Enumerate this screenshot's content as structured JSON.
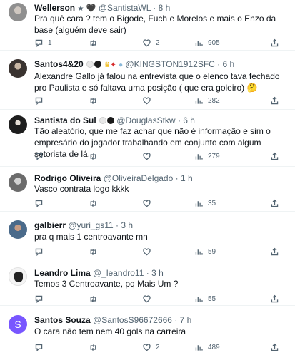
{
  "tweets": [
    {
      "name": "Wellerson",
      "name_suffix": "★",
      "handle": "@SantistaWL",
      "time": "8 h",
      "text": "Pra quê cara ? tem o Bigode, Fuch e Morelos e mais o Enzo da base (alguém deve sair)",
      "replies": "1",
      "retweets": "",
      "likes": "2",
      "views": "905"
    },
    {
      "name": "Santos4&20",
      "handle": "@KINGSTON1912SFC",
      "time": "6 h",
      "text": "Alexandre Gallo já falou na entrevista que o elenco tava fechado pro Paulista e só faltava uma posição ( que era goleiro) 🤔",
      "replies": "",
      "retweets": "",
      "likes": "",
      "views": "282"
    },
    {
      "name": "Santista do Sul",
      "handle": "@DouglasStkw",
      "time": "6 h",
      "text": "Tão aleatório, que me faz achar que não é informação e sim o empresário do jogador trabalhando em conjunto com algum setorista de lá...",
      "replies": "",
      "retweets": "",
      "likes": "",
      "views": "279"
    },
    {
      "name": "Rodrigo Oliveira",
      "handle": "@OliveiraDelgado",
      "time": "1 h",
      "text": "Vasco contrata logo kkkk",
      "replies": "",
      "retweets": "",
      "likes": "",
      "views": "35"
    },
    {
      "name": "galbierr",
      "handle": "@yuri_gs11",
      "time": "3 h",
      "text": "pra q mais 1 centroavante mn",
      "replies": "",
      "retweets": "",
      "likes": "",
      "views": "59"
    },
    {
      "name": "Leandro Lima",
      "handle": "@_leandro11",
      "time": "3 h",
      "text": "Temos 3 Centroavante, pq Mais Um ?",
      "replies": "",
      "retweets": "",
      "likes": "",
      "views": "55"
    },
    {
      "name": "Santos Souza",
      "handle": "@SantosS96672666",
      "time": "7 h",
      "text": "O cara não tem nem 40 gols na carreira",
      "replies": "",
      "retweets": "",
      "likes": "2",
      "views": "489",
      "avatar_letter": "S"
    }
  ],
  "icons": {
    "reply": "reply-icon",
    "retweet": "retweet-icon",
    "like": "heart-icon",
    "views": "views-icon",
    "share": "share-icon"
  },
  "colors": {
    "name": "#0f1419",
    "muted": "#536471",
    "divider": "#eff3f4",
    "avatar_s": "#7856ff"
  }
}
